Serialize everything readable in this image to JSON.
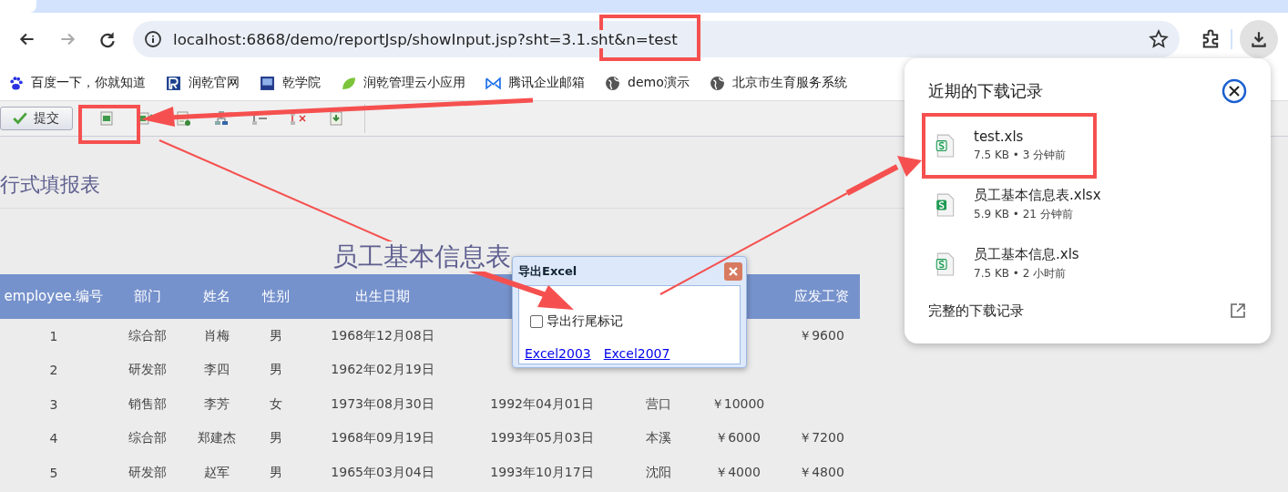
{
  "browser": {
    "url": "localhost:6868/demo/reportJsp/showInput.jsp?sht=3.1.sht&n=test",
    "bookmarks": [
      "百度一下，你就知道",
      "润乾官网",
      "乾学院",
      "润乾管理云小应用",
      "腾讯企业邮箱",
      "demo演示",
      "北京市生育服务系统"
    ]
  },
  "toolbar": {
    "submit": "提交"
  },
  "page": {
    "section_title": "行式填报表",
    "report_title": "员工基本信息表",
    "columns": [
      "employee.编号",
      "部门",
      "姓名",
      "性别",
      "出生日期",
      null,
      null,
      null,
      "应发工资"
    ],
    "rows": [
      [
        "1",
        "综合部",
        "肖梅",
        "男",
        "1968年12月08日",
        null,
        null,
        null,
        "￥9600"
      ],
      [
        "2",
        "研发部",
        "李四",
        "男",
        "1962年02月19日",
        null,
        null,
        null,
        null
      ],
      [
        "3",
        "销售部",
        "李芳",
        "女",
        "1973年08月30日",
        "1992年04月01日",
        "营口",
        "￥10000",
        null
      ],
      [
        "4",
        "综合部",
        "郑建杰",
        "男",
        "1968年09月19日",
        "1993年05月03日",
        "本溪",
        "￥6000",
        "￥7200"
      ],
      [
        "5",
        "研发部",
        "赵军",
        "男",
        "1965年03月04日",
        "1993年10月17日",
        "沈阳",
        "￥4000",
        "￥4800"
      ]
    ]
  },
  "dialog": {
    "title": "导出Excel",
    "option": {
      "label": "导出行尾标记",
      "checked": false
    },
    "links": [
      "Excel2003",
      "Excel2007"
    ]
  },
  "downloads": {
    "title": "近期的下载记录",
    "items": [
      {
        "name": "test.xls",
        "meta": "7.5 KB • 3 分钟前",
        "kind": "xls"
      },
      {
        "name": "员工基本信息表.xlsx",
        "meta": "5.9 KB • 21 分钟前",
        "kind": "xlsx"
      },
      {
        "name": "员工基本信息.xls",
        "meta": "7.5 KB • 2 小时前",
        "kind": "xls"
      }
    ],
    "footer": "完整的下载记录"
  }
}
